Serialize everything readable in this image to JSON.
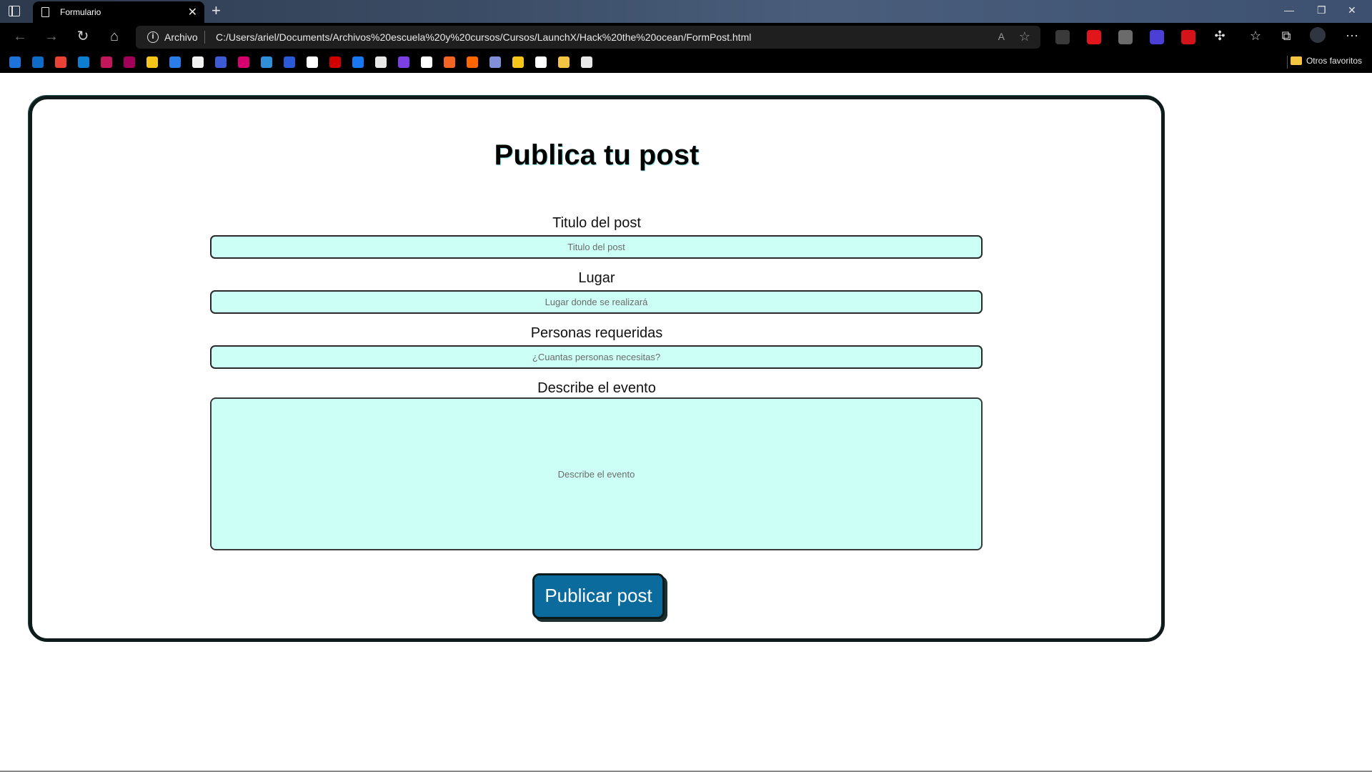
{
  "browser": {
    "tab_title": "Formulario",
    "tab_close": "✕",
    "new_tab": "+",
    "window_controls": [
      "—",
      "❐",
      "✕"
    ],
    "address": {
      "protocol_label": "Archivo",
      "url": "C:/Users/ariel/Documents/Archivos%20escuela%20y%20cursos/Cursos/LaunchX/Hack%20the%20ocean/FormPost.html",
      "read_aloud": "A",
      "add_favorite": "☆"
    },
    "other_favorites": "Otros favoritos",
    "extension_colors": [
      "#3a3a3a",
      "#e0161b",
      "#6b6b6b",
      "#4b3fd6",
      "#d4141a"
    ],
    "bookmark_colors": [
      "#1e73d8",
      "#0e6bc7",
      "#ea4335",
      "#0c7fd0",
      "#c2185b",
      "#a0005a",
      "#f5c518",
      "#2b7de9",
      "#f2f2f2",
      "#3e5bd6",
      "#d6006f",
      "#2f8fd8",
      "#2a5ad8",
      "#ffffff",
      "#d10000",
      "#1877f2",
      "#e8e8e8",
      "#7b3fe4",
      "#ffffff",
      "#f26522",
      "#ff6600",
      "#7f8fd8",
      "#f5c518",
      "#ffffff",
      "#f4c542",
      "#e8e8e8"
    ]
  },
  "form": {
    "title": "Publica tu post",
    "fields": [
      {
        "label": "Titulo del post",
        "placeholder": "Titulo del post"
      },
      {
        "label": "Lugar",
        "placeholder": "Lugar donde se realizará"
      },
      {
        "label": "Personas requeridas",
        "placeholder": "¿Cuantas personas necesitas?"
      },
      {
        "label": "Describe el evento",
        "placeholder": "Describe el evento"
      }
    ],
    "submit_label": "Publicar post"
  }
}
